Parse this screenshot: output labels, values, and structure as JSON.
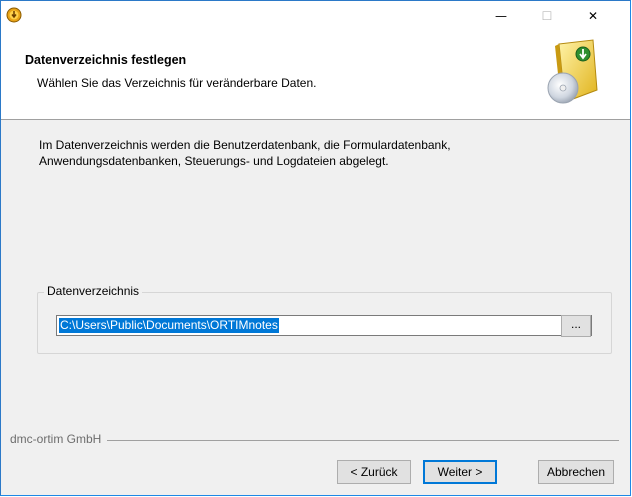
{
  "window": {
    "controls": {
      "minimize": "—",
      "maximize": "☐",
      "close": "✕"
    }
  },
  "header": {
    "title": "Datenverzeichnis festlegen",
    "subtitle": "Wählen Sie das Verzeichnis für veränderbare Daten."
  },
  "body": {
    "info_line1": "Im Datenverzeichnis werden die Benutzerdatenbank, die Formulardatenbank,",
    "info_line2": "Anwendungsdatenbanken, Steuerungs- und Logdateien abgelegt."
  },
  "data_directory": {
    "group_label": "Datenverzeichnis",
    "path_value": "C:\\Users\\Public\\Documents\\ORTIMnotes",
    "browse_label": "..."
  },
  "footer": {
    "company": "dmc-ortim GmbH",
    "back_label": "< Zurück",
    "next_label": "Weiter >",
    "cancel_label": "Abbrechen"
  },
  "colors": {
    "accent": "#0078d7",
    "dialog_bg": "#f0f0f0",
    "header_bg": "#ffffff"
  }
}
